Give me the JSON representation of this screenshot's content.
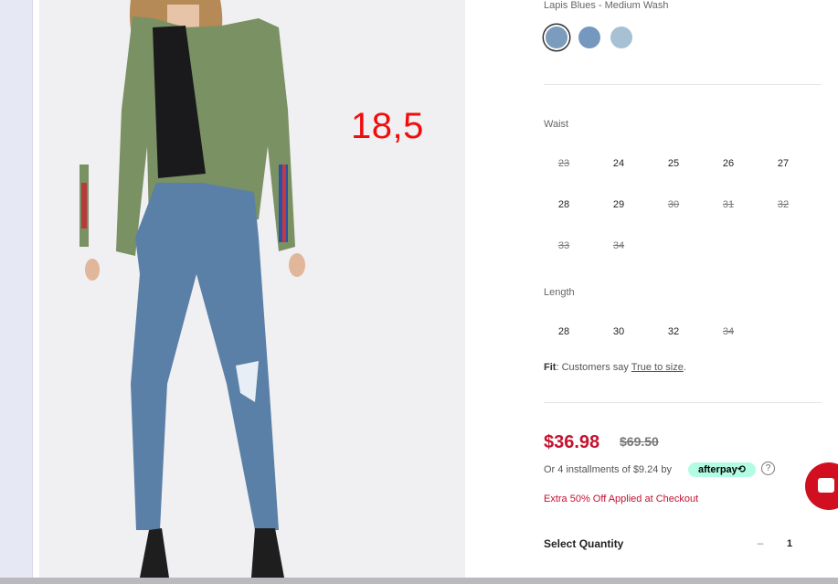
{
  "annotation": {
    "text": "18,5"
  },
  "product": {
    "color_name": "Lapis Blues - Medium Wash",
    "swatches": [
      {
        "name": "lapis-blues-medium-wash",
        "color": "#7b9cbd",
        "selected": true
      },
      {
        "name": "medium-blue-wash",
        "color": "#7498be",
        "selected": false
      },
      {
        "name": "light-blue-wash",
        "color": "#a6c0d4",
        "selected": false
      }
    ],
    "waist": {
      "label": "Waist",
      "sizes": [
        {
          "value": "23",
          "available": false
        },
        {
          "value": "24",
          "available": true
        },
        {
          "value": "25",
          "available": true
        },
        {
          "value": "26",
          "available": true
        },
        {
          "value": "27",
          "available": true
        },
        {
          "value": "28",
          "available": true
        },
        {
          "value": "29",
          "available": true
        },
        {
          "value": "30",
          "available": false
        },
        {
          "value": "31",
          "available": false
        },
        {
          "value": "32",
          "available": false
        },
        {
          "value": "33",
          "available": false
        },
        {
          "value": "34",
          "available": false
        }
      ]
    },
    "length": {
      "label": "Length",
      "sizes": [
        {
          "value": "28",
          "available": true
        },
        {
          "value": "30",
          "available": true
        },
        {
          "value": "32",
          "available": true
        },
        {
          "value": "34",
          "available": false
        }
      ]
    },
    "fit": {
      "label": "Fit",
      "text": ": Customers say ",
      "link": "True to size",
      "end": "."
    },
    "price": {
      "sale": "$36.98",
      "original": "$69.50",
      "installments": "Or 4 installments of $9.24 by",
      "afterpay": "afterpay⟲",
      "help": "?",
      "promo": "Extra 50% Off Applied at Checkout"
    },
    "quantity": {
      "label": "Select Quantity",
      "minus": "–",
      "value": "1"
    }
  },
  "colors": {
    "sale": "#c41230",
    "afterpay": "#b2fce4",
    "chat": "#d10f21",
    "jacket": "#7a9163",
    "jeans": "#5a80a8"
  }
}
